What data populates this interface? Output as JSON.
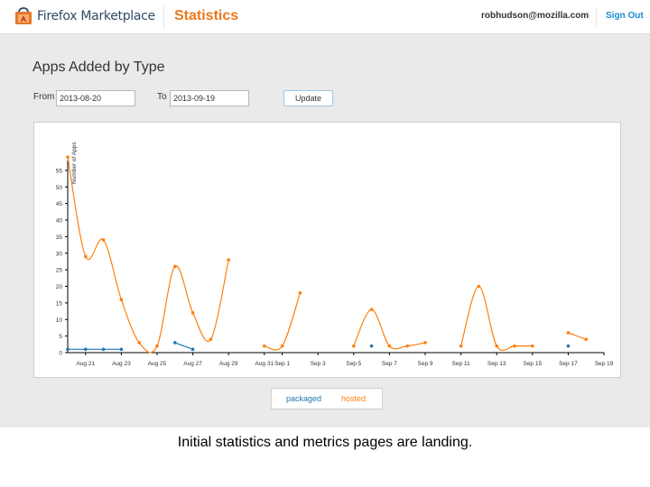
{
  "header": {
    "brand": "Firefox Marketplace",
    "page_title": "Statistics",
    "user_email": "robhudson@mozilla.com",
    "signout_label": "Sign Out"
  },
  "main": {
    "title": "Apps Added by Type",
    "from_label": "From",
    "from_value": "2013-08-20",
    "to_label": "To",
    "to_value": "2013-09-19",
    "update_label": "Update"
  },
  "legend": {
    "packaged": "packaged",
    "hosted": "hosted"
  },
  "caption": "Initial statistics and metrics pages are landing.",
  "colors": {
    "packaged": "#1f77b4",
    "hosted": "#ff7f0e",
    "accent": "#e87a1c",
    "link": "#1a8ccf"
  },
  "chart_data": {
    "type": "line",
    "ylabel": "Number of Apps",
    "ylim": [
      0,
      58
    ],
    "yticks": [
      0,
      5,
      10,
      15,
      20,
      25,
      30,
      35,
      40,
      45,
      50,
      55
    ],
    "xticks": [
      "Aug 21",
      "Aug 23",
      "Aug 25",
      "Aug 27",
      "Aug 29",
      "Aug 31",
      "Sep 1",
      "Sep 3",
      "Sep 5",
      "Sep 7",
      "Sep 9",
      "Sep 11",
      "Sep 13",
      "Sep 15",
      "Sep 17",
      "Sep 19"
    ],
    "series": [
      {
        "name": "packaged",
        "color": "#1f77b4",
        "segments": [
          [
            [
              "2013-08-20",
              1
            ],
            [
              "2013-08-21",
              1
            ],
            [
              "2013-08-22",
              1
            ],
            [
              "2013-08-23",
              1
            ]
          ],
          [
            [
              "2013-08-26",
              3
            ],
            [
              "2013-08-27",
              1
            ]
          ],
          [
            [
              "2013-09-06",
              2
            ]
          ],
          [
            [
              "2013-09-17",
              2
            ]
          ]
        ]
      },
      {
        "name": "hosted",
        "color": "#ff7f0e",
        "segments": [
          [
            [
              "2013-08-20",
              59
            ],
            [
              "2013-08-21",
              29
            ],
            [
              "2013-08-22",
              34
            ],
            [
              "2013-08-23",
              16
            ],
            [
              "2013-08-24",
              3
            ],
            [
              "2013-08-25",
              2
            ],
            [
              "2013-08-26",
              26
            ],
            [
              "2013-08-27",
              12
            ],
            [
              "2013-08-28",
              4
            ],
            [
              "2013-08-29",
              28
            ]
          ],
          [
            [
              "2013-08-31",
              2
            ],
            [
              "2013-09-01",
              2
            ],
            [
              "2013-09-02",
              18
            ]
          ],
          [
            [
              "2013-09-05",
              2
            ],
            [
              "2013-09-06",
              13
            ],
            [
              "2013-09-07",
              2
            ],
            [
              "2013-09-08",
              2
            ],
            [
              "2013-09-09",
              3
            ]
          ],
          [
            [
              "2013-09-11",
              2
            ],
            [
              "2013-09-12",
              20
            ],
            [
              "2013-09-13",
              2
            ],
            [
              "2013-09-14",
              2
            ],
            [
              "2013-09-15",
              2
            ]
          ],
          [
            [
              "2013-09-17",
              6
            ],
            [
              "2013-09-18",
              4
            ]
          ]
        ]
      }
    ]
  }
}
